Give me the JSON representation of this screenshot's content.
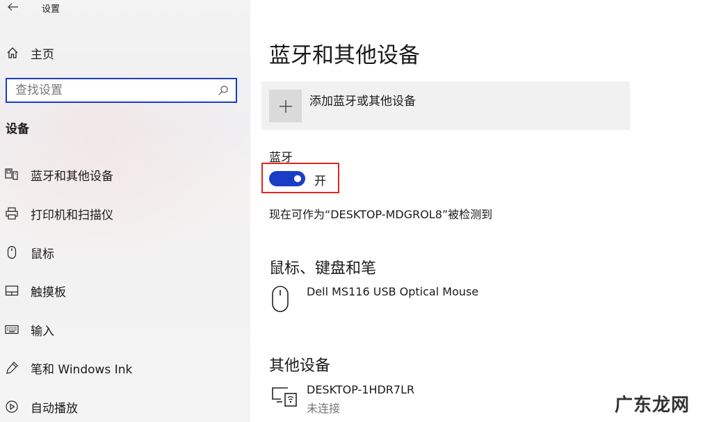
{
  "window": {
    "title": "设置"
  },
  "sidebar": {
    "home_label": "主页",
    "search_placeholder": "查找设置",
    "section_title": "设备",
    "items": [
      {
        "label": "蓝牙和其他设备",
        "icon": "bluetooth-devices-icon"
      },
      {
        "label": "打印机和扫描仪",
        "icon": "printer-icon"
      },
      {
        "label": "鼠标",
        "icon": "mouse-icon"
      },
      {
        "label": "触摸板",
        "icon": "touchpad-icon"
      },
      {
        "label": "输入",
        "icon": "keyboard-icon"
      },
      {
        "label": "笔和 Windows Ink",
        "icon": "pen-icon"
      },
      {
        "label": "自动播放",
        "icon": "autoplay-icon"
      }
    ]
  },
  "main": {
    "title": "蓝牙和其他设备",
    "add_device_label": "添加蓝牙或其他设备",
    "bluetooth": {
      "label": "蓝牙",
      "state": "开",
      "discoverable_text": "现在可作为“DESKTOP-MDGROL8”被检测到"
    },
    "mouse_section": {
      "title": "鼠标、键盘和笔",
      "devices": [
        {
          "name": "Dell MS116 USB Optical Mouse"
        }
      ]
    },
    "other_section": {
      "title": "其他设备",
      "devices": [
        {
          "name": "DESKTOP-1HDR7LR",
          "status": "未连接"
        }
      ]
    }
  },
  "watermark": "广东龙网",
  "colors": {
    "accent": "#1a3dc6",
    "highlight": "#e52222"
  }
}
